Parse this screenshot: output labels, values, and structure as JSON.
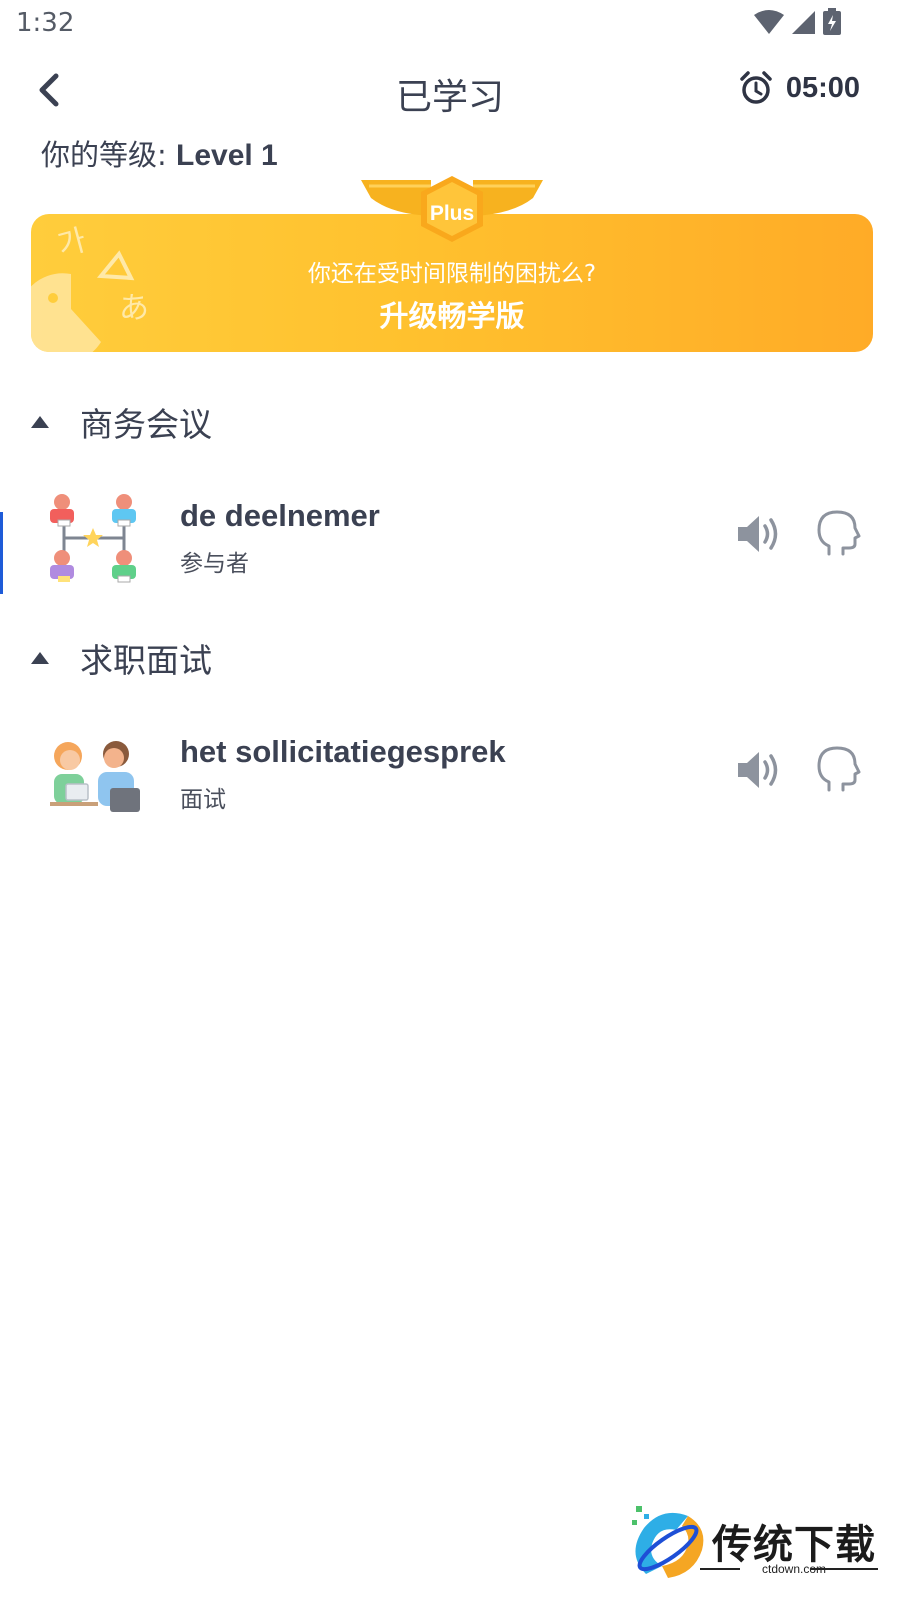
{
  "status_bar": {
    "time": "1:32",
    "icons": [
      "wifi-icon",
      "cell-signal-icon",
      "battery-charging-icon"
    ]
  },
  "header": {
    "title": "已学习",
    "timer": "05:00",
    "back_icon": "chevron-left-icon",
    "timer_icon": "alarm-clock-icon"
  },
  "level": {
    "label": "你的等级: ",
    "value": "Level 1"
  },
  "promo": {
    "badge": "Plus",
    "subtitle": "你还在受时间限制的困扰么?",
    "cta": "升级畅学版",
    "deco_chars": [
      "가",
      "あ"
    ],
    "colors": {
      "start": "#ffcd3c",
      "end": "#ffab27"
    }
  },
  "sections": [
    {
      "title": "商务会议",
      "items": [
        {
          "word": "de deelnemer",
          "translation": "参与者",
          "image": "meeting-participants-icon"
        }
      ]
    },
    {
      "title": "求职面试",
      "items": [
        {
          "word": "het sollicitatiegesprek",
          "translation": "面试",
          "image": "job-interview-icon"
        }
      ]
    }
  ],
  "item_actions": {
    "speaker_icon": "speaker-icon",
    "speak_icon": "speaking-head-icon"
  },
  "watermark": {
    "text": "传统下载",
    "domain": "ctdown.com"
  }
}
